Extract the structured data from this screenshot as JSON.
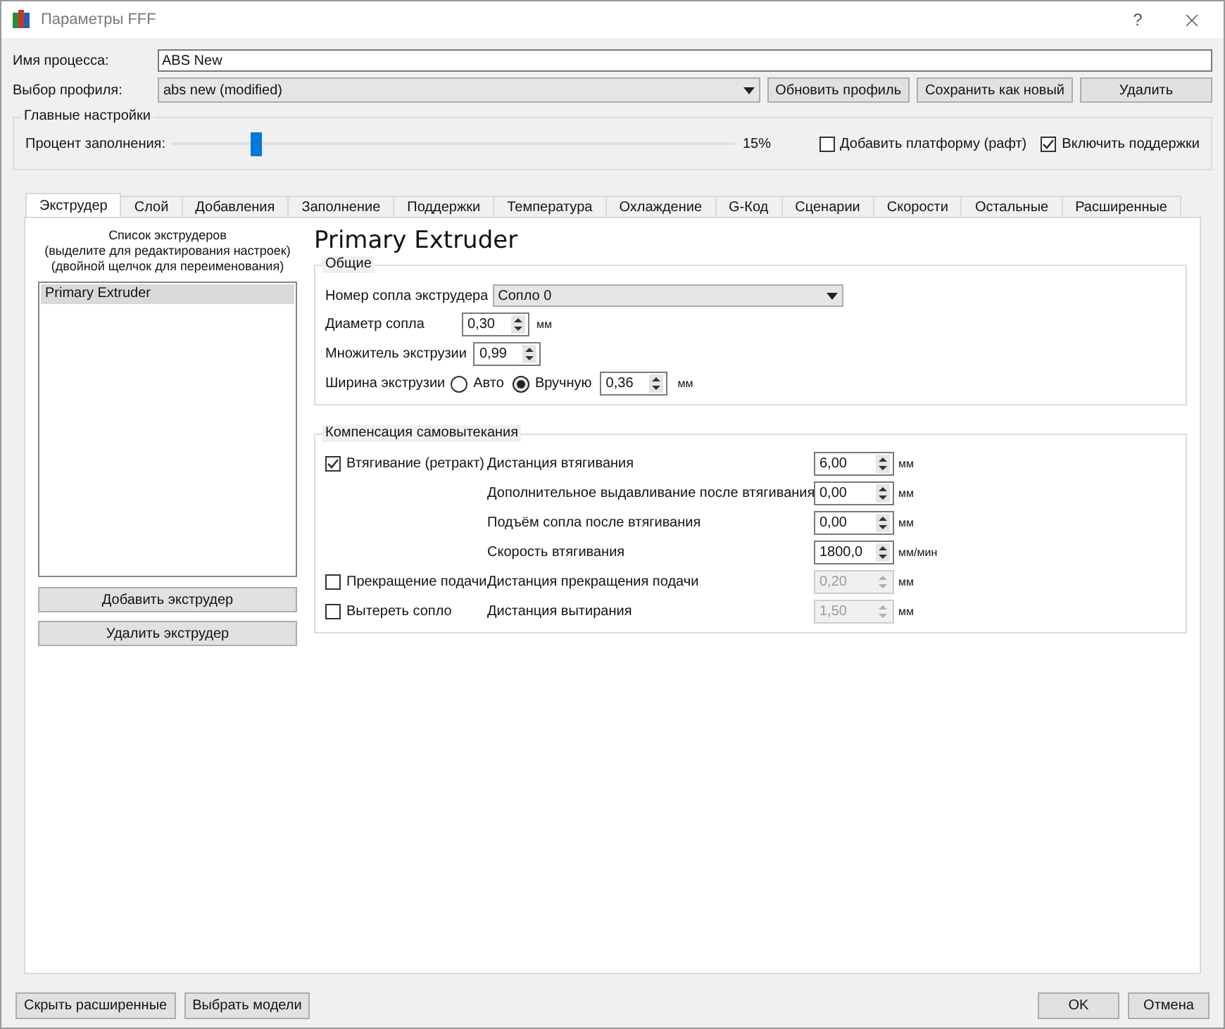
{
  "window": {
    "title": "Параметры FFF",
    "help": "?"
  },
  "process": {
    "label": "Имя процесса:",
    "value": "ABS New"
  },
  "profile": {
    "label": "Выбор профиля:",
    "value": "abs new (modified)",
    "buttons": [
      "Обновить профиль",
      "Сохранить как новый",
      "Удалить"
    ]
  },
  "main_settings": {
    "title": "Главные настройки",
    "infill_label": "Процент заполнения:",
    "infill": {
      "level": 0.15
    },
    "infill_reading": "15%",
    "options": [
      {
        "label": "Добавить платформу (рафт)",
        "checked": false
      },
      {
        "label": "Включить поддержки",
        "checked": true
      }
    ]
  },
  "tabs": [
    {
      "label": "Экструдер",
      "selected": true
    },
    {
      "label": "Слой",
      "selected": false
    },
    {
      "label": "Добавления",
      "selected": false
    },
    {
      "label": "Заполнение",
      "selected": false
    },
    {
      "label": "Поддержки",
      "selected": false
    },
    {
      "label": "Температура",
      "selected": false
    },
    {
      "label": "Охлаждение",
      "selected": false
    },
    {
      "label": "G-Код",
      "selected": false
    },
    {
      "label": "Сценарии",
      "selected": false
    },
    {
      "label": "Скорости",
      "selected": false
    },
    {
      "label": "Остальные",
      "selected": false
    },
    {
      "label": "Расширенные",
      "selected": false
    }
  ],
  "extruder_list": {
    "caption": [
      "Список экструдеров",
      "(выделите для редактирования настроек)",
      "(двойной щелчок для переименования)"
    ],
    "items": [
      {
        "label": "Primary Extruder",
        "selected": true
      }
    ],
    "buttons": [
      "Добавить экструдер",
      "Удалить экструдер"
    ]
  },
  "extruder": {
    "title": "Primary Extruder",
    "general": {
      "title": "Общие",
      "nozzle": {
        "label": "Номер сопла экструдера",
        "value": "Сопло 0"
      },
      "diameter": {
        "label": "Диаметр сопла",
        "value": "0,30",
        "unit": "мм"
      },
      "multiplier": {
        "label": "Множитель экструзии",
        "value": "0,99"
      },
      "width": {
        "label": "Ширина экструзии",
        "options": [
          {
            "label": "Авто",
            "selected": false
          },
          {
            "label": "Вручную",
            "selected": true
          }
        ],
        "value": "0,36",
        "unit": "мм"
      }
    },
    "ooze": {
      "title": "Компенсация самовытекания",
      "rows": [
        {
          "checkbox": {
            "label": "Втягивание (ретракт)",
            "checked": true
          },
          "label": "Дистанция втягивания",
          "value": "6,00",
          "unit": "мм",
          "disabled": false
        },
        {
          "label": "Дополнительное выдавливание после втягивания",
          "value": "0,00",
          "unit": "мм",
          "disabled": false
        },
        {
          "label": "Подъём сопла после втягивания",
          "value": "0,00",
          "unit": "мм",
          "disabled": false
        },
        {
          "label": "Скорость втягивания",
          "value": "1800,0",
          "unit": "мм/мин",
          "disabled": false
        },
        {
          "checkbox": {
            "label": "Прекращение подачи",
            "checked": false
          },
          "label": "Дистанция прекращения подачи",
          "value": "0,20",
          "unit": "мм",
          "disabled": true
        },
        {
          "checkbox": {
            "label": "Вытереть сопло",
            "checked": false
          },
          "label": "Дистанция вытирания",
          "value": "1,50",
          "unit": "мм",
          "disabled": true
        }
      ]
    }
  },
  "footer": {
    "left": [
      "Скрыть расширенные",
      "Выбрать модели"
    ],
    "right": [
      "OK",
      "Отмена"
    ]
  }
}
